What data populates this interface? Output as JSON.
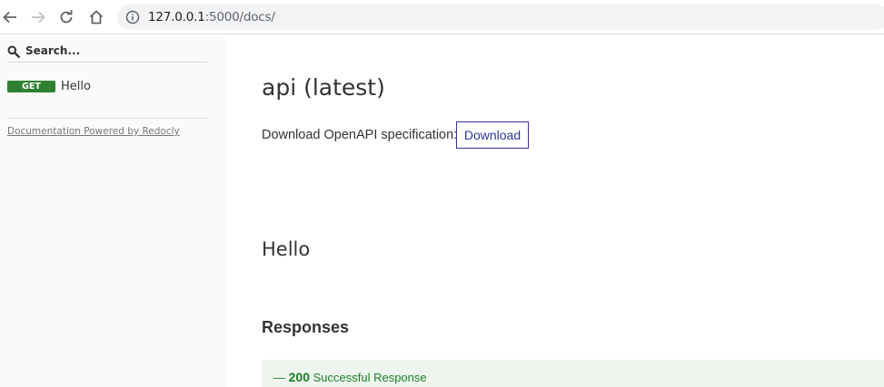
{
  "browser": {
    "url_host": "127.0.0.1",
    "url_path": ":5000/docs/"
  },
  "sidebar": {
    "search_placeholder": "Search...",
    "items": [
      {
        "method": "GET",
        "label": "Hello"
      }
    ],
    "powered_by": "Documentation Powered by Redocly"
  },
  "main": {
    "title": "api (latest)",
    "download_label": "Download OpenAPI specification:",
    "download_button": "Download",
    "operation_title": "Hello",
    "responses_title": "Responses",
    "responses": [
      {
        "prefix": "— ",
        "code": "200",
        "description": "Successful Response"
      }
    ]
  },
  "colors": {
    "get_badge": "#2f8132",
    "download_accent": "#32329f",
    "response_success_bg": "#edf5ee",
    "response_success_text": "#1d8127"
  }
}
